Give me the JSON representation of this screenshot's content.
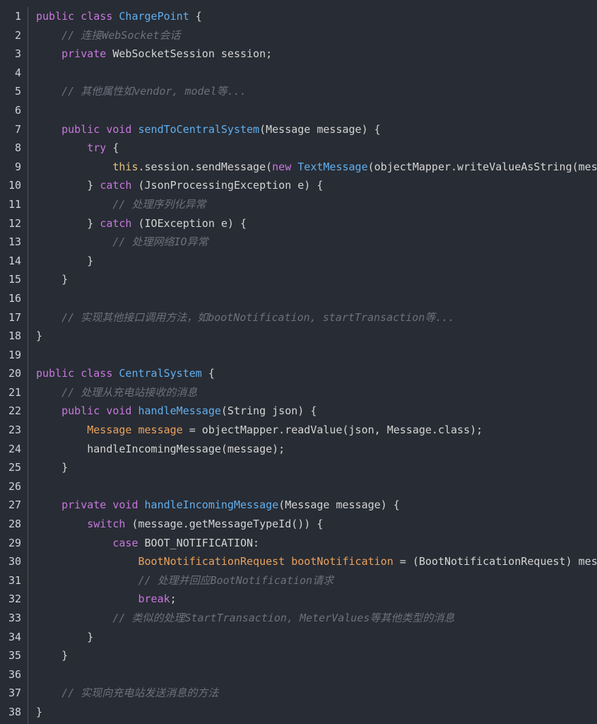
{
  "lines": [
    {
      "n": "1",
      "tokens": [
        [
          "kw",
          "public class "
        ],
        [
          "cls",
          "ChargePoint"
        ],
        [
          "plain",
          " {"
        ]
      ]
    },
    {
      "n": "2",
      "tokens": [
        [
          "plain",
          "    "
        ],
        [
          "cmt",
          "// 连接WebSocket会话"
        ]
      ]
    },
    {
      "n": "3",
      "tokens": [
        [
          "plain",
          "    "
        ],
        [
          "kw",
          "private "
        ],
        [
          "plain",
          "WebSocketSession session;"
        ]
      ]
    },
    {
      "n": "4",
      "tokens": []
    },
    {
      "n": "5",
      "tokens": [
        [
          "plain",
          "    "
        ],
        [
          "cmt",
          "// 其他属性如vendor, model等..."
        ]
      ]
    },
    {
      "n": "6",
      "tokens": []
    },
    {
      "n": "7",
      "tokens": [
        [
          "plain",
          "    "
        ],
        [
          "kw",
          "public void "
        ],
        [
          "fn",
          "sendToCentralSystem"
        ],
        [
          "plain",
          "(Message message) {"
        ]
      ]
    },
    {
      "n": "8",
      "tokens": [
        [
          "plain",
          "        "
        ],
        [
          "kw",
          "try"
        ],
        [
          "plain",
          " {"
        ]
      ]
    },
    {
      "n": "9",
      "tokens": [
        [
          "plain",
          "            "
        ],
        [
          "yel",
          "this"
        ],
        [
          "plain",
          ".session.sendMessage("
        ],
        [
          "kw",
          "new "
        ],
        [
          "cls",
          "TextMessage"
        ],
        [
          "plain",
          "(objectMapper.writeValueAsString(message)));"
        ]
      ]
    },
    {
      "n": "10",
      "tokens": [
        [
          "plain",
          "        } "
        ],
        [
          "kw",
          "catch"
        ],
        [
          "plain",
          " (JsonProcessingException e) {"
        ]
      ]
    },
    {
      "n": "11",
      "tokens": [
        [
          "plain",
          "            "
        ],
        [
          "cmt",
          "// 处理序列化异常"
        ]
      ]
    },
    {
      "n": "12",
      "tokens": [
        [
          "plain",
          "        } "
        ],
        [
          "kw",
          "catch"
        ],
        [
          "plain",
          " (IOException e) {"
        ]
      ]
    },
    {
      "n": "13",
      "tokens": [
        [
          "plain",
          "            "
        ],
        [
          "cmt",
          "// 处理网络IO异常"
        ]
      ]
    },
    {
      "n": "14",
      "tokens": [
        [
          "plain",
          "        }"
        ]
      ]
    },
    {
      "n": "15",
      "tokens": [
        [
          "plain",
          "    }"
        ]
      ]
    },
    {
      "n": "16",
      "tokens": []
    },
    {
      "n": "17",
      "tokens": [
        [
          "plain",
          "    "
        ],
        [
          "cmt",
          "// 实现其他接口调用方法，如bootNotification, startTransaction等..."
        ]
      ]
    },
    {
      "n": "18",
      "tokens": [
        [
          "plain",
          "}"
        ]
      ]
    },
    {
      "n": "19",
      "tokens": []
    },
    {
      "n": "20",
      "tokens": [
        [
          "kw",
          "public class "
        ],
        [
          "cls",
          "CentralSystem"
        ],
        [
          "plain",
          " {"
        ]
      ]
    },
    {
      "n": "21",
      "tokens": [
        [
          "plain",
          "    "
        ],
        [
          "cmt",
          "// 处理从充电站接收的消息"
        ]
      ]
    },
    {
      "n": "22",
      "tokens": [
        [
          "plain",
          "    "
        ],
        [
          "kw",
          "public void "
        ],
        [
          "fn",
          "handleMessage"
        ],
        [
          "plain",
          "(String json) {"
        ]
      ]
    },
    {
      "n": "23",
      "tokens": [
        [
          "plain",
          "        "
        ],
        [
          "org",
          "Message message"
        ],
        [
          "plain",
          " = objectMapper.readValue(json, Message.class);"
        ]
      ]
    },
    {
      "n": "24",
      "tokens": [
        [
          "plain",
          "        handleIncomingMessage(message);"
        ]
      ]
    },
    {
      "n": "25",
      "tokens": [
        [
          "plain",
          "    }"
        ]
      ]
    },
    {
      "n": "26",
      "tokens": []
    },
    {
      "n": "27",
      "tokens": [
        [
          "plain",
          "    "
        ],
        [
          "kw",
          "private void "
        ],
        [
          "fn",
          "handleIncomingMessage"
        ],
        [
          "plain",
          "(Message message) {"
        ]
      ]
    },
    {
      "n": "28",
      "tokens": [
        [
          "plain",
          "        "
        ],
        [
          "kw",
          "switch"
        ],
        [
          "plain",
          " (message.getMessageTypeId()) {"
        ]
      ]
    },
    {
      "n": "29",
      "tokens": [
        [
          "plain",
          "            "
        ],
        [
          "kw",
          "case"
        ],
        [
          "plain",
          " BOOT_NOTIFICATION:"
        ]
      ]
    },
    {
      "n": "30",
      "tokens": [
        [
          "plain",
          "                "
        ],
        [
          "org",
          "BootNotificationRequest bootNotification"
        ],
        [
          "plain",
          " = (BootNotificationRequest) message.getPayload();"
        ]
      ]
    },
    {
      "n": "31",
      "tokens": [
        [
          "plain",
          "                "
        ],
        [
          "cmt",
          "// 处理并回应BootNotification请求"
        ]
      ]
    },
    {
      "n": "32",
      "tokens": [
        [
          "plain",
          "                "
        ],
        [
          "kw",
          "break"
        ],
        [
          "plain",
          ";"
        ]
      ]
    },
    {
      "n": "33",
      "tokens": [
        [
          "plain",
          "            "
        ],
        [
          "cmt",
          "// 类似的处理StartTransaction, MeterValues等其他类型的消息"
        ]
      ]
    },
    {
      "n": "34",
      "tokens": [
        [
          "plain",
          "        }"
        ]
      ]
    },
    {
      "n": "35",
      "tokens": [
        [
          "plain",
          "    }"
        ]
      ]
    },
    {
      "n": "36",
      "tokens": []
    },
    {
      "n": "37",
      "tokens": [
        [
          "plain",
          "    "
        ],
        [
          "cmt",
          "// 实现向充电站发送消息的方法"
        ]
      ]
    },
    {
      "n": "38",
      "tokens": [
        [
          "plain",
          "}"
        ]
      ]
    }
  ]
}
